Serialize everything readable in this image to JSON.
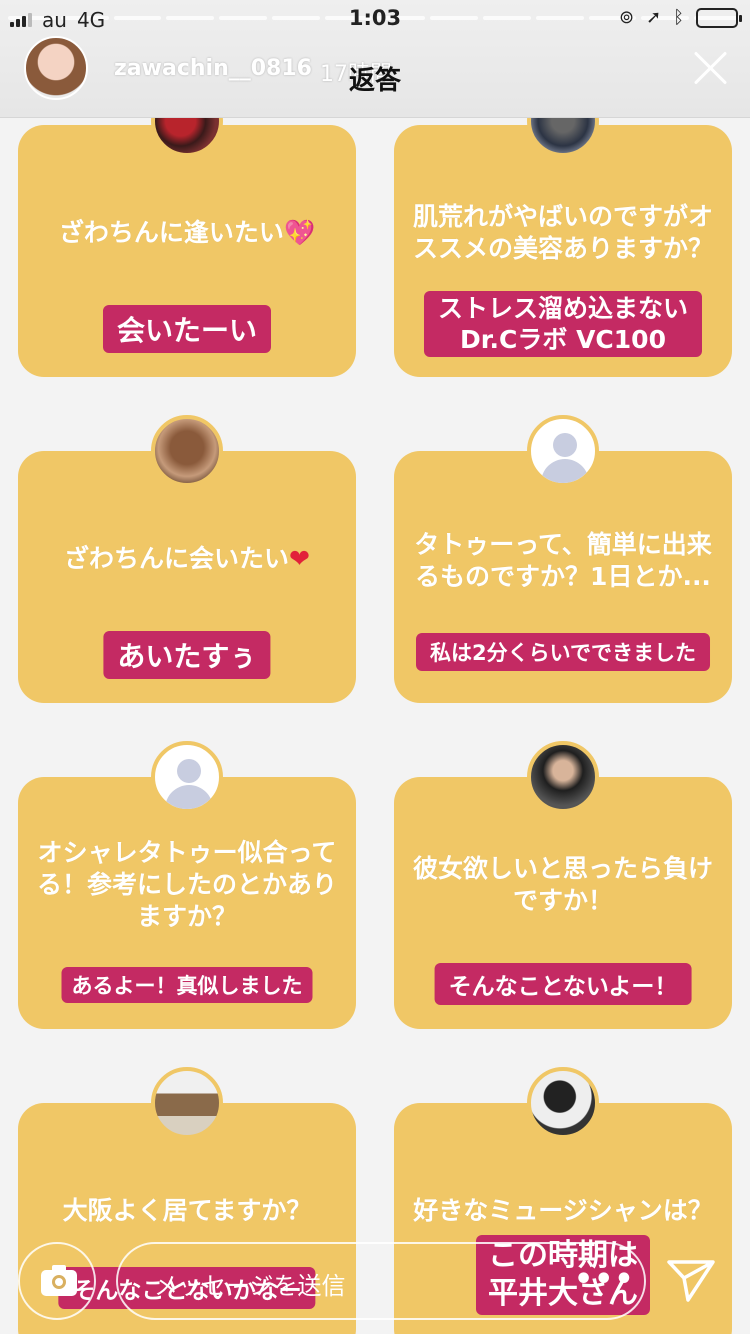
{
  "status": {
    "carrier": "au",
    "network": "4G",
    "time": "1:03"
  },
  "header": {
    "username": "zawachin__0816",
    "time_ago": "17時間",
    "title": "返答"
  },
  "cards": [
    {
      "question": "ざわちんに逢いたい",
      "emoji": "💖",
      "answer_lines": [
        "会いたーい"
      ]
    },
    {
      "question": "肌荒れがやばいのですがオススメの美容ありますか？",
      "emoji": "",
      "answer_lines": [
        "ストレス溜め込まない",
        "Dr.Cラボ VC100"
      ]
    },
    {
      "question": "ざわちんに会いたい",
      "emoji": "❤",
      "answer_lines": [
        "あいたすぅ"
      ]
    },
    {
      "question": "タトゥーって、簡単に出来るものですか？1日とか...",
      "emoji": "",
      "answer_lines": [
        "私は2分くらいでできました"
      ]
    },
    {
      "question": "オシャレタトゥー似合ってる！参考にしたのとかありますか？",
      "emoji": "",
      "answer_lines": [
        "あるよー！真似しました"
      ]
    },
    {
      "question": "彼女欲しいと思ったら負けですか！",
      "emoji": "",
      "answer_lines": [
        "そんなことないよー！"
      ]
    },
    {
      "question": "大阪よく居てますか？",
      "emoji": "",
      "answer_lines": [
        "そんなことないかなー"
      ]
    },
    {
      "question": "好きなミュージシャンは？",
      "emoji": "",
      "answer_lines": [
        "この時期は",
        "平井大さん"
      ]
    }
  ],
  "bottom": {
    "message_placeholder": "メッセージを送信",
    "more": "•••"
  },
  "icons": {
    "close": "close-icon",
    "camera": "camera-icon",
    "send": "send-icon",
    "more": "more-icon"
  },
  "colors": {
    "card": "#f0c766",
    "answer_badge": "#c42a63",
    "heart": "#e2213a"
  }
}
